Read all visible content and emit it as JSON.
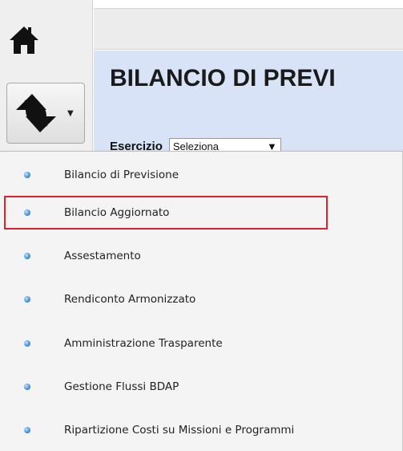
{
  "header": {
    "title": "BILANCIO DI PREVI",
    "exercise_label": "Esercizio",
    "exercise_select_value": "Seleziona"
  },
  "toolbar": {
    "home_icon": "home-icon",
    "switch_icon": "switch-arrows-icon",
    "caret": "▼"
  },
  "menu": {
    "items": [
      {
        "label": "Bilancio di Previsione"
      },
      {
        "label": "Bilancio Aggiornato"
      },
      {
        "label": "Assestamento"
      },
      {
        "label": "Rendiconto Armonizzato"
      },
      {
        "label": "Amministrazione Trasparente"
      },
      {
        "label": "Gestione Flussi BDAP"
      },
      {
        "label": "Ripartizione Costi su Missioni e Programmi"
      }
    ]
  },
  "colors": {
    "main_background": "#d8e3f7",
    "highlight_border": "#e0202a",
    "bullet": "#3f8fd8"
  }
}
